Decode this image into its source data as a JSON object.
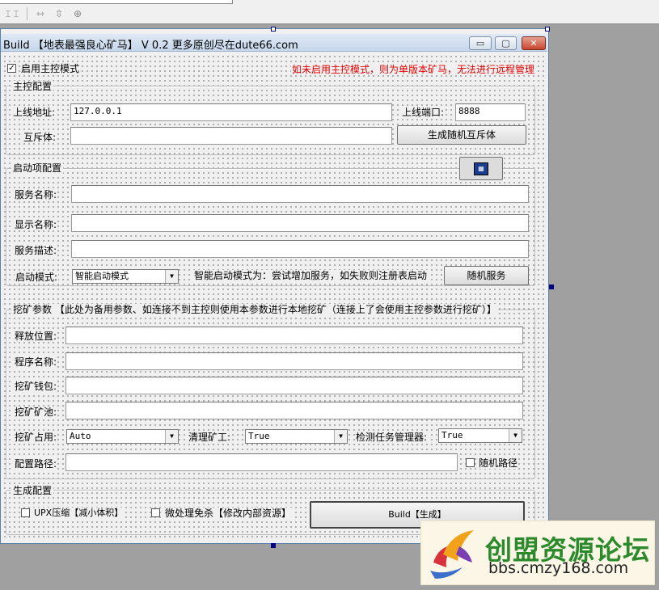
{
  "window": {
    "title": "Build 【地表最强良心矿马】 V 0.2   更多原创尽在dute66.com"
  },
  "main_control": {
    "enable_label": "启用主控模式",
    "enable_checked": "✓",
    "warning": "如未启用主控模式，则为单版本矿马，无法进行远程管理",
    "group_title": "主控配置",
    "addr_label": "上线地址:",
    "addr_value": "127.0.0.1",
    "port_label": "上线端口:",
    "port_value": "8888",
    "mutex_label": "互斥体:",
    "mutex_value": "",
    "mutex_button": "生成随机互斥体"
  },
  "startup": {
    "group_title": "启动项配置",
    "service_name_label": "服务名称:",
    "service_name_value": "",
    "display_name_label": "显示名称:",
    "display_name_value": "",
    "service_desc_label": "服务描述:",
    "service_desc_value": "",
    "mode_label": "启动模式:",
    "mode_value": "智能启动模式",
    "mode_hint": "智能启动模式为：尝试增加服务，如失败则注册表启动",
    "random_button": "随机服务"
  },
  "mining": {
    "group_title": "挖矿参数 【此处为备用参数、如连接不到主控则使用本参数进行本地挖矿（连接上了会使用主控参数进行挖矿）】",
    "release_label": "释放位置:",
    "release_value": "",
    "program_label": "程序名称:",
    "program_value": "",
    "wallet_label": "挖矿钱包:",
    "wallet_value": "",
    "pool_label": "挖矿矿池:",
    "pool_value": "",
    "usage_label": "挖矿占用:",
    "usage_value": "Auto",
    "clean_label": "清理矿工:",
    "clean_value": "True",
    "taskmgr_label": "检测任务管理器:",
    "taskmgr_value": "True",
    "config_path_label": "配置路径:",
    "config_path_value": "",
    "random_path_label": "随机路径"
  },
  "build": {
    "group_title": "生成配置",
    "upx_label": "UPX压缩【减小体积】",
    "mini_label": "微处理免杀【修改内部资源】",
    "build_button": "Build【生成】"
  },
  "watermark": {
    "brand": "创盟资源论坛",
    "url": "bbs.cmzy168.com"
  },
  "colors": {
    "warning_red": "#e00000",
    "watermark_green": "#2c8a2c"
  }
}
